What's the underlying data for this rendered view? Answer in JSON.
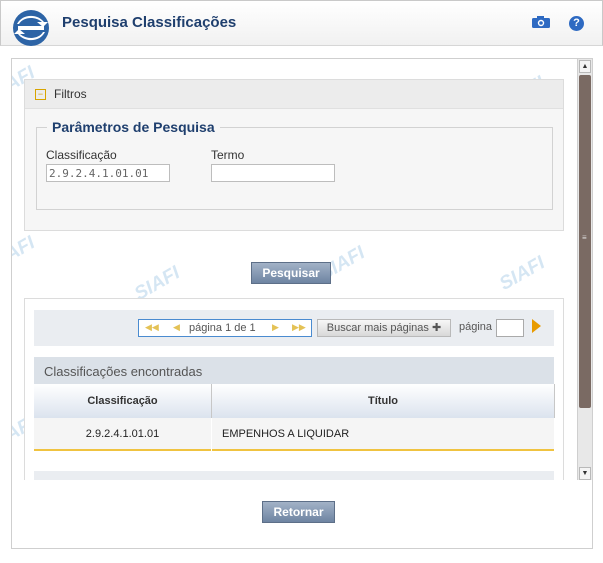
{
  "header": {
    "title": "Pesquisa Classificações",
    "help_label": "?"
  },
  "watermark": "SIAFI",
  "filtros": {
    "label": "Filtros",
    "legend": "Parâmetros de Pesquisa",
    "classificacao_label": "Classificação",
    "classificacao_value": "2.9.2.4.1.01.01",
    "termo_label": "Termo",
    "termo_value": ""
  },
  "pesquisar_label": "Pesquisar",
  "pager": {
    "text": "página 1 de 1",
    "buscar_mais": "Buscar mais páginas",
    "pagina_label": "página"
  },
  "results": {
    "title": "Classificações encontradas",
    "columns": [
      "Classificação",
      "Título"
    ],
    "rows": [
      [
        "2.9.2.4.1.01.01",
        "EMPENHOS A LIQUIDAR"
      ]
    ]
  },
  "retornar_label": "Retornar"
}
